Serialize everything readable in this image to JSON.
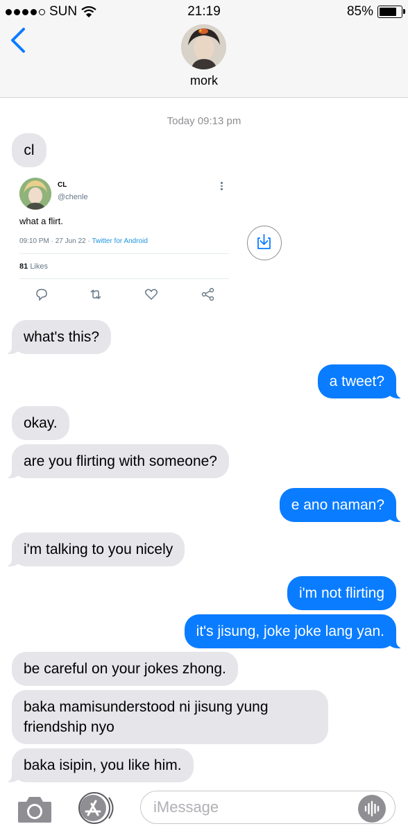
{
  "status_bar": {
    "carrier": "SUN",
    "time": "21:19",
    "battery": "85%",
    "battery_level": 0.85,
    "signal_bars_filled": 4,
    "signal_bars_total": 5,
    "icons": [
      "signal-dots-icon",
      "wifi-icon",
      "battery-icon"
    ]
  },
  "header": {
    "contact_name": "mork",
    "back_icon": "chevron-left-icon"
  },
  "thread": {
    "timestamp_day": "Today",
    "timestamp_time": "09:13 pm",
    "tweet": {
      "name": "CL",
      "handle": "@chenle",
      "text": "what a flirt.",
      "meta_time": "09:10 PM · 27 Jun 22 · ",
      "meta_source": "Twitter for Android",
      "likes_count": "81",
      "likes_label": "Likes",
      "action_icons": [
        "reply-icon",
        "retweet-icon",
        "like-icon",
        "share-icon"
      ]
    },
    "messages": [
      {
        "from": "them",
        "text": "cl"
      },
      {
        "from": "them",
        "text": "what's this?"
      },
      {
        "from": "me",
        "text": "a tweet?"
      },
      {
        "from": "them",
        "text": "okay."
      },
      {
        "from": "them",
        "text": "are you flirting with someone?"
      },
      {
        "from": "me",
        "text": "e ano naman?"
      },
      {
        "from": "them",
        "text": "i'm talking to you nicely"
      },
      {
        "from": "me",
        "text": "i'm not flirting"
      },
      {
        "from": "me",
        "text": "it's jisung, joke joke lang yan."
      },
      {
        "from": "them",
        "text": "be careful on your jokes zhong."
      },
      {
        "from": "them",
        "text": "baka mamisunderstood ni jisung yung friendship nyo"
      },
      {
        "from": "them",
        "text": "baka isipin, you like him."
      }
    ]
  },
  "composer": {
    "placeholder": "iMessage",
    "icons": [
      "camera-icon",
      "app-store-icon",
      "voice-message-icon"
    ]
  },
  "colors": {
    "incoming_bubble": "#e5e5ea",
    "outgoing_bubble": "#0a7cff",
    "accent": "#0a7cff",
    "header_bg": "#f6f6f7"
  }
}
